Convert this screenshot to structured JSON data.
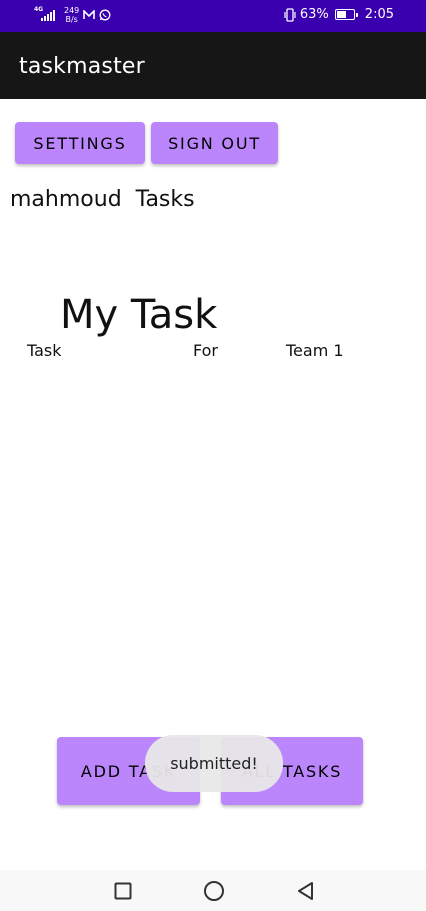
{
  "status_bar": {
    "network_type": "4G",
    "speed_value": "249",
    "speed_unit": "B/s",
    "battery_percent": "63%",
    "battery_level": 0.63,
    "time": "2:05",
    "background_color": "#3a00b0",
    "icons": [
      "signal-icon",
      "mail-icon",
      "whatsapp-icon",
      "vibrate-icon",
      "battery-charging-icon"
    ]
  },
  "app_bar": {
    "title": "taskmaster",
    "background_color": "#161616"
  },
  "top_buttons": {
    "settings_label": "SETTINGS",
    "sign_out_label": "SIGN OUT"
  },
  "main": {
    "user_tasks_heading": "mahmoud  Tasks",
    "task_title": "My Task",
    "task_label": "Task",
    "for_label": "For",
    "team_label": "Team 1"
  },
  "bottom_buttons": {
    "add_task_label": "ADD TASK",
    "all_tasks_label": "ALL TASKS"
  },
  "toast": {
    "message": "submitted!"
  },
  "nav_bar": {
    "icons": [
      "recent-apps-icon",
      "home-icon",
      "back-icon"
    ]
  },
  "colors": {
    "accent": "#bb86fc"
  }
}
